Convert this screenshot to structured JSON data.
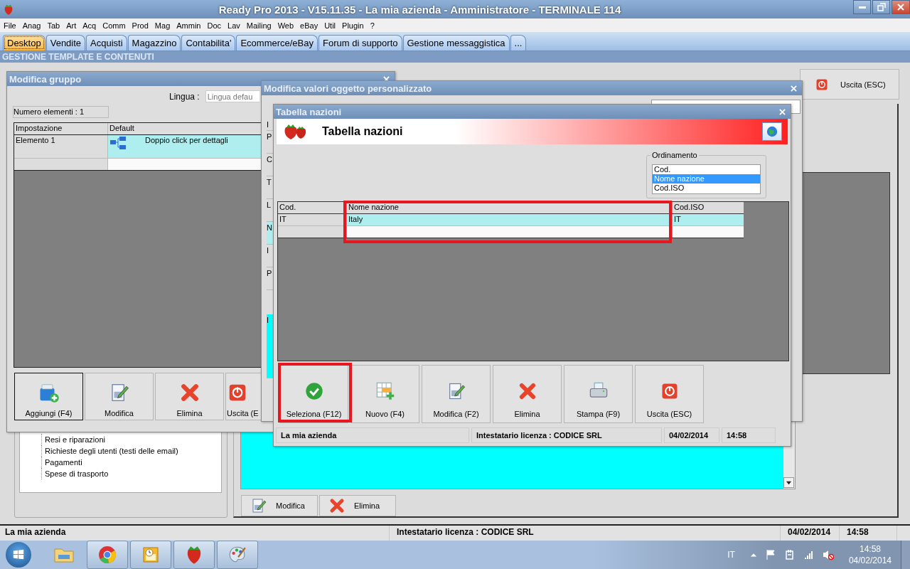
{
  "app": {
    "title": "Ready Pro 2013 - V15.11.35 - La mia azienda - Amministratore - TERMINALE 114"
  },
  "menu": [
    "File",
    "Anag",
    "Tab",
    "Art",
    "Acq",
    "Comm",
    "Prod",
    "Mag",
    "Ammin",
    "Doc",
    "Lav",
    "Mailing",
    "Web",
    "eBay",
    "Util",
    "Plugin",
    "?"
  ],
  "tabs": [
    {
      "label": "Desktop",
      "selected": true
    },
    {
      "label": "Vendite",
      "selected": false
    },
    {
      "label": "Acquisti",
      "selected": false
    },
    {
      "label": "Magazzino",
      "selected": false
    },
    {
      "label": "Contabilita'",
      "selected": false
    },
    {
      "label": "Ecommerce/eBay",
      "selected": false
    },
    {
      "label": "Forum di supporto",
      "selected": false
    },
    {
      "label": "Gestione messaggistica",
      "selected": false
    },
    {
      "label": "...",
      "selected": false
    }
  ],
  "section_title": "GESTIONE TEMPLATE E CONTENUTI",
  "background": {
    "exit_button": "Uscita (ESC)",
    "tree_items": [
      "Resi e riparazioni",
      "Richieste degli utenti (testi delle email)",
      "Pagamenti",
      "Spese di trasporto"
    ],
    "buttons": [
      "Modifica",
      "Elimina"
    ]
  },
  "group_window": {
    "title": "Modifica gruppo",
    "language_label": "Lingua :",
    "language_value": "Lingua defau",
    "count": "Numero elementi : 1",
    "columns": [
      "Impostazione",
      "Default"
    ],
    "rows": [
      {
        "setting": "Elemento 1",
        "value": "Doppio click per dettagli",
        "selected": true
      }
    ],
    "buttons": [
      {
        "label": "Aggiungi (F4)",
        "focused": true
      },
      {
        "label": "Modifica",
        "focused": false
      },
      {
        "label": "Elimina",
        "focused": false
      },
      {
        "label": "Uscita (E",
        "focused": false
      }
    ]
  },
  "object_window": {
    "title": "Modifica valori oggetto personalizzato",
    "column_1": [
      {
        "text": "I",
        "highlighted": false
      },
      {
        "text": "P",
        "highlighted": false
      },
      {
        "text": "C",
        "highlighted": false
      },
      {
        "text": "T",
        "highlighted": false
      },
      {
        "text": "L",
        "highlighted": false
      },
      {
        "text": "N",
        "highlighted": true
      },
      {
        "text": "I",
        "highlighted": false
      },
      {
        "text": "P",
        "highlighted": false
      },
      {
        "text": "I",
        "highlighted": true
      }
    ]
  },
  "nations_window": {
    "title": "Tabella nazioni",
    "header": "Tabella nazioni",
    "sort_label": "Ordinamento",
    "sort_options": [
      {
        "label": "Cod.",
        "selected": false
      },
      {
        "label": "Nome nazione",
        "selected": true
      },
      {
        "label": "Cod.ISO",
        "selected": false
      }
    ],
    "columns": [
      "Cod.",
      "Nome nazione",
      "Cod.ISO"
    ],
    "rows": [
      {
        "cells": [
          "IT",
          "Italy",
          "IT"
        ],
        "selected": true
      }
    ],
    "buttons": [
      "Seleziona (F12)",
      "Nuovo (F4)",
      "Modifica (F2)",
      "Elimina",
      "Stampa (F9)",
      "Uscita (ESC)"
    ],
    "status": [
      "La mia azienda",
      "Intestatario licenza : CODICE SRL",
      "04/02/2014",
      "14:58"
    ]
  },
  "status_bar": [
    "La mia azienda",
    "Intestatario licenza : CODICE SRL",
    "04/02/2014",
    "14:58"
  ],
  "taskbar": {
    "language": "IT",
    "time": "14:58",
    "date": "04/02/2014"
  }
}
